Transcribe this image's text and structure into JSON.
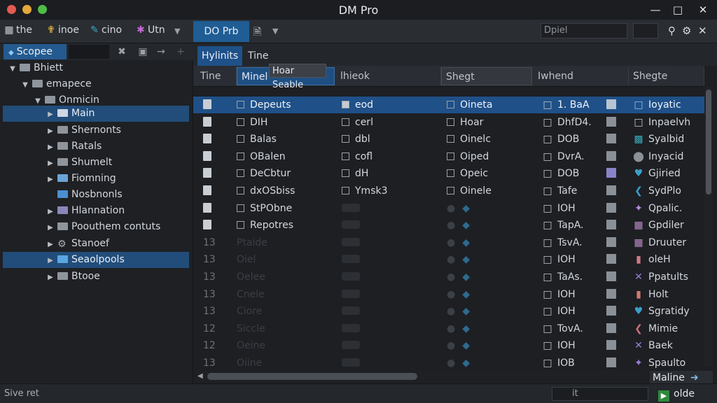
{
  "window": {
    "title": "DM Pro"
  },
  "toolbar": {
    "items": [
      {
        "label": "the",
        "icon": "grid-icon"
      },
      {
        "label": "inoe",
        "icon": "pin-icon"
      },
      {
        "label": "cino",
        "icon": "brush-icon"
      },
      {
        "label": "Utn",
        "icon": "tools-icon"
      }
    ],
    "doc_tab": "DO Prb",
    "filter_placeholder": "Dpiel"
  },
  "sidebar": {
    "scope": "Scopee",
    "tree": [
      {
        "label": "Bhiett",
        "level": 0,
        "expanded": true
      },
      {
        "label": "emapece",
        "level": 1,
        "expanded": true
      },
      {
        "label": "Onmicin",
        "level": 2,
        "expanded": true
      },
      {
        "label": "Main",
        "level": 3,
        "selected": true
      },
      {
        "label": "Shernonts",
        "level": 3
      },
      {
        "label": "Ratals",
        "level": 3
      },
      {
        "label": "Shumelt",
        "level": 3
      },
      {
        "label": "Fiomning",
        "level": 3
      },
      {
        "label": "Nosbnonls",
        "level": 3
      },
      {
        "label": "Hlannation",
        "level": 3
      },
      {
        "label": "Poouthem contuts",
        "level": 3
      },
      {
        "label": "Stanoef",
        "level": 3
      },
      {
        "label": "Seaolpools",
        "level": 3,
        "selected": true
      },
      {
        "label": "Btooe",
        "level": 3
      }
    ]
  },
  "main": {
    "tabs": [
      "Hylinits",
      "Tine"
    ],
    "columns": [
      "Tine",
      "Minel",
      "lhieok",
      "Shegt",
      "Iwhend",
      "Shegte"
    ],
    "tooltip": "Hoar Seable",
    "rows": [
      {
        "name": "Depeuts",
        "c2": "eod",
        "c3": "Oineta",
        "c4": "1. BaA",
        "c5": "Ioyatic",
        "selected": true,
        "checked": true
      },
      {
        "name": "DIH",
        "c2": "cerl",
        "c3": "Hoar",
        "c4": "DhfD4.",
        "c5": "Inpaelvh"
      },
      {
        "name": "Balas",
        "c2": "dbl",
        "c3": "Oinelc",
        "c4": "DOB",
        "c5": "Syalbid"
      },
      {
        "name": "OBalen",
        "c2": "cofl",
        "c3": "Oiped",
        "c4": "DvrA.",
        "c5": "Inyacid"
      },
      {
        "name": "DeCbtur",
        "c2": "dH",
        "c3": "Opeic",
        "c4": "DOB",
        "c5": "Gjiried"
      },
      {
        "name": "dxOSbiss",
        "c2": "Ymsk3",
        "c3": "Oinele",
        "c4": "Tafe",
        "c5": "SydPlo"
      },
      {
        "name": "StPObne",
        "c2": "",
        "c3": "",
        "c4": "IOH",
        "c5": "Qpalic."
      },
      {
        "name": "Repotres",
        "c2": "",
        "c3": "",
        "c4": "TapA.",
        "c5": "Gpdiler"
      },
      {
        "name": "Ptaide",
        "c2": "",
        "c3": "",
        "c4": "TsvA.",
        "c5": "Druuter"
      },
      {
        "name": "Oiel",
        "c2": "",
        "c3": "",
        "c4": "IOH",
        "c5": "oleH"
      },
      {
        "name": "Oelee",
        "c2": "",
        "c3": "",
        "c4": "TaAs.",
        "c5": "Ppatults"
      },
      {
        "name": "Cnele",
        "c2": "",
        "c3": "",
        "c4": "IOH",
        "c5": "Holt"
      },
      {
        "name": "Ciore",
        "c2": "",
        "c3": "",
        "c4": "IOH",
        "c5": "Sgratidy"
      },
      {
        "name": "Siccle",
        "c2": "",
        "c3": "",
        "c4": "TovA.",
        "c5": "Mimie"
      },
      {
        "name": "Oeine",
        "c2": "",
        "c3": "",
        "c4": "IOH",
        "c5": "Baek"
      },
      {
        "name": "Oiine",
        "c2": "",
        "c3": "",
        "c4": "IOB",
        "c5": "Spaulto"
      }
    ],
    "row_numbers": [
      "",
      "",
      "",
      "",
      "",
      "",
      "",
      "",
      "13",
      "13",
      "13",
      "13",
      "13",
      "12",
      "12",
      "13"
    ],
    "mode_label": "Maline"
  },
  "status": {
    "text": "Sive ret",
    "field_value": "it",
    "button_label": "olde"
  },
  "colors": {
    "accent": "#1f5d94",
    "selection": "#224d7a",
    "bg": "#1c1e22"
  }
}
